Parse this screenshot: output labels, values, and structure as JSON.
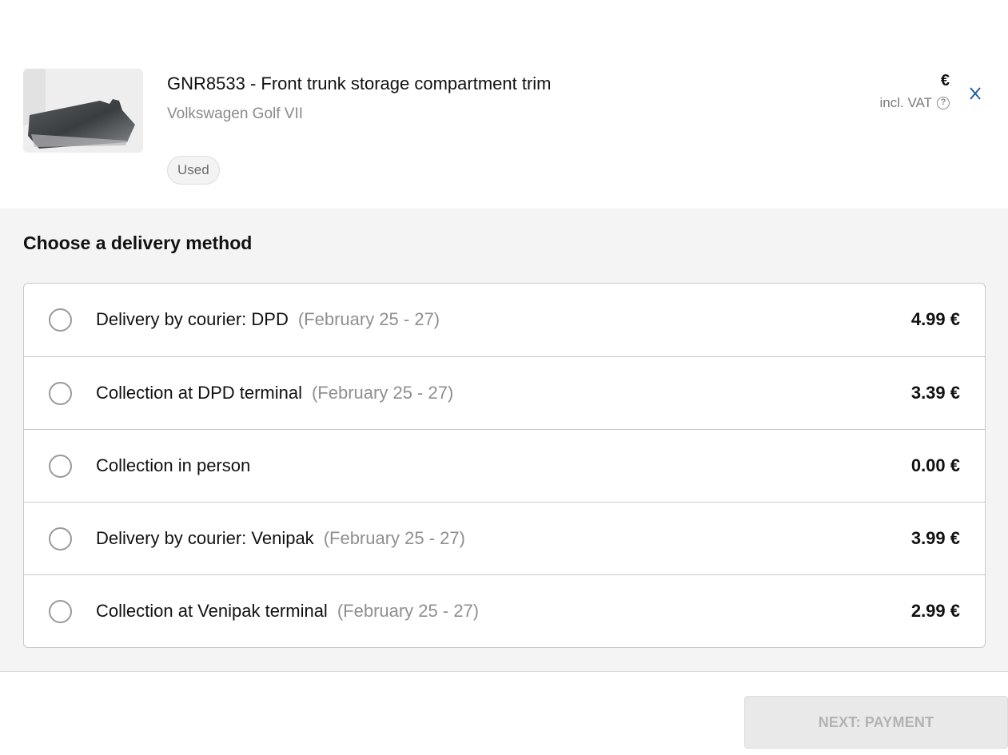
{
  "product": {
    "title": "GNR8533 - Front trunk storage compartment trim",
    "vehicle": "Volkswagen Golf VII",
    "condition": "Used",
    "price": "€",
    "vat_label": "incl. VAT",
    "help_icon": "?",
    "thumbnail": "car-part-photo"
  },
  "delivery": {
    "heading": "Choose a delivery method",
    "options": [
      {
        "label": "Delivery by courier: DPD",
        "date": "(February 25 - 27)",
        "price": "4.99 €"
      },
      {
        "label": "Collection at DPD terminal",
        "date": "(February 25 - 27)",
        "price": "3.39 €"
      },
      {
        "label": "Collection in person",
        "date": "",
        "price": "0.00 €"
      },
      {
        "label": "Delivery by courier: Venipak",
        "date": "(February 25 - 27)",
        "price": "3.99 €"
      },
      {
        "label": "Collection at Venipak terminal",
        "date": "(February 25 - 27)",
        "price": "2.99 €"
      }
    ]
  },
  "footer": {
    "next_label": "NEXT: PAYMENT"
  },
  "colors": {
    "close_icon": "#1f5fa6",
    "panel_bg": "#f4f4f4",
    "button_disabled_bg": "#e9e9e9",
    "muted_text": "#8f8f8f"
  }
}
